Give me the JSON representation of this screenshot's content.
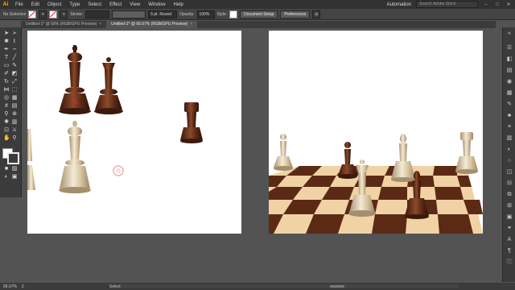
{
  "app": {
    "logo": "Ai",
    "workspace": "Automation",
    "search_placeholder": "Search Adobe Stock"
  },
  "menu": [
    "File",
    "Edit",
    "Object",
    "Type",
    "Select",
    "Effect",
    "View",
    "Window",
    "Help"
  ],
  "controlbar": {
    "selection_label": "No Selection",
    "stroke_label": "Stroke:",
    "brush_value": "5 pt. Round",
    "opacity_label": "Opacity:",
    "opacity_value": "100%",
    "style_label": "Style:",
    "document_setup": "Document Setup",
    "preferences": "Preferences"
  },
  "tabs": [
    {
      "label": "Untitled-1* @ 58% (RGB/GPU Preview)",
      "active": false
    },
    {
      "label": "Untitled-2* @ 66.67% (RGB/GPU Preview)",
      "active": true
    }
  ],
  "status": {
    "zoom": "66.67%",
    "page": "2",
    "tool": "Selection"
  },
  "colors": {
    "dark_piece": "#5a2a16",
    "light_piece": "#d9c7a7",
    "board_dark": "#5b2a15",
    "board_light": "#f1d2a5"
  }
}
